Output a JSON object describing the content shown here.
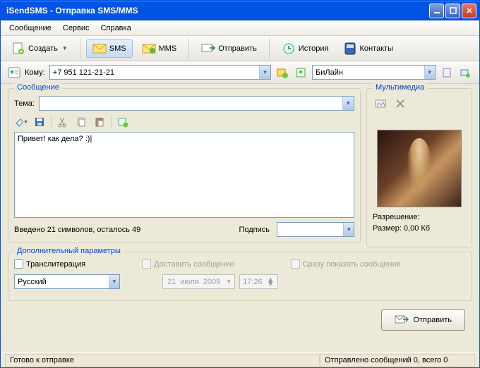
{
  "window": {
    "title": "iSendSMS - Отправка SMS/MMS"
  },
  "menu": {
    "message": "Сообщение",
    "service": "Сервис",
    "help": "Справка"
  },
  "toolbar": {
    "create": "Создать",
    "sms": "SMS",
    "mms": "MMS",
    "send": "Отправить",
    "history": "История",
    "contacts": "Контакты"
  },
  "address": {
    "to_label": "Кому:",
    "to_value": "+7 951 121-21-21",
    "operator": "БиЛайн"
  },
  "message": {
    "group": "Сообщение",
    "topic_label": "Тема:",
    "topic_value": "",
    "body": "Привет! как дела?  :)",
    "counter": "Введено 21 символов, осталось 49",
    "signature_label": "Подпись",
    "signature_value": ""
  },
  "multimedia": {
    "group": "Мультимедиа",
    "resolution_label": "Разрешение:",
    "size_label": "Размер: 0,00 Кб"
  },
  "extra": {
    "group": "Дополнительный параметры",
    "translit": "Транслитерация",
    "deliver": "Доставить сообщение",
    "show_now": "Сразу показать сообщение",
    "language": "Русский",
    "date_day": "21",
    "date_month": "июля",
    "date_year": "2009",
    "time": "17:26"
  },
  "bottom": {
    "send": "Отправить"
  },
  "status": {
    "ready": "Готово к отправке",
    "sent": "Отправлено сообщений 0, всего 0"
  },
  "icons": {
    "create": "document-new-icon",
    "sms": "envelope-sms-icon",
    "mms": "envelope-mms-icon",
    "send": "mail-send-icon",
    "history": "history-icon",
    "contacts": "addressbook-icon"
  }
}
